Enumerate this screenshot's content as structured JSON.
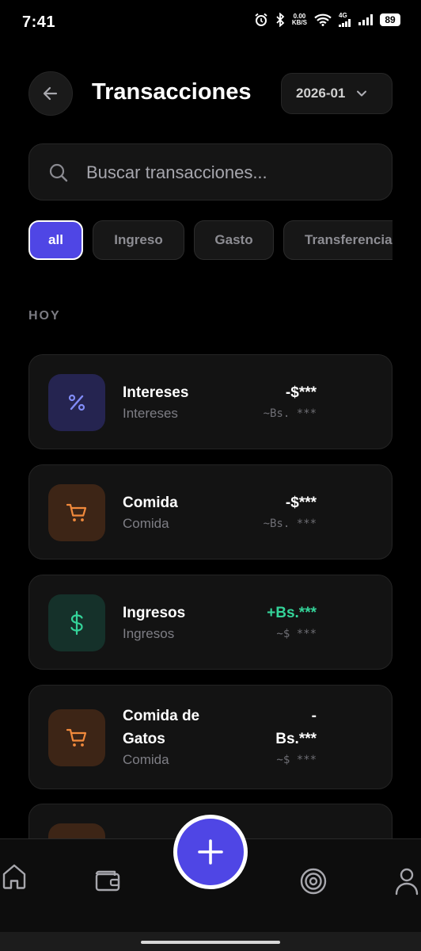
{
  "status_bar": {
    "time": "7:41",
    "net_speed_value": "0.00",
    "net_speed_unit": "KB/S",
    "network_type": "4G",
    "battery": "89"
  },
  "header": {
    "title": "Transacciones",
    "month": "2026-01"
  },
  "search": {
    "placeholder": "Buscar transacciones..."
  },
  "filters": [
    {
      "label": "all",
      "active": true
    },
    {
      "label": "Ingreso",
      "active": false
    },
    {
      "label": "Gasto",
      "active": false
    },
    {
      "label": "Transferencia",
      "active": false
    }
  ],
  "section": {
    "label": "HOY"
  },
  "transactions": [
    {
      "title": "Intereses",
      "category": "Intereses",
      "amount": "-$***",
      "converted": "~Bs. ***",
      "icon": "percent-icon",
      "amount_color": "#ffffff",
      "icon_color": "#818cf8",
      "icon_bg": "#252450"
    },
    {
      "title": "Comida",
      "category": "Comida",
      "amount": "-$***",
      "converted": "~Bs. ***",
      "icon": "cart-icon",
      "amount_color": "#ffffff",
      "icon_color": "#f28a3c",
      "icon_bg": "#3d2516"
    },
    {
      "title": "Ingresos",
      "category": "Ingresos",
      "amount": "+Bs.***",
      "converted": "~$ ***",
      "icon": "dollar-icon",
      "amount_color": "#34d399",
      "icon_color": "#34d399",
      "icon_bg": "#15312a"
    },
    {
      "title_line1": "Comida de",
      "title_line2": "Gatos",
      "category": "Comida",
      "amount_line1": "-",
      "amount_line2": "Bs.***",
      "converted": "~$ ***",
      "icon": "cart-icon",
      "amount_color": "#ffffff",
      "icon_color": "#f28a3c",
      "icon_bg": "#3d2516"
    },
    {
      "icon": "cart-icon",
      "icon_bg": "#3d2516"
    }
  ],
  "bottom_nav": [
    {
      "icon": "home-icon"
    },
    {
      "icon": "wallet-icon"
    },
    {
      "icon": "target-icon"
    },
    {
      "icon": "profile-icon"
    }
  ],
  "fab": {
    "icon": "plus-icon"
  }
}
